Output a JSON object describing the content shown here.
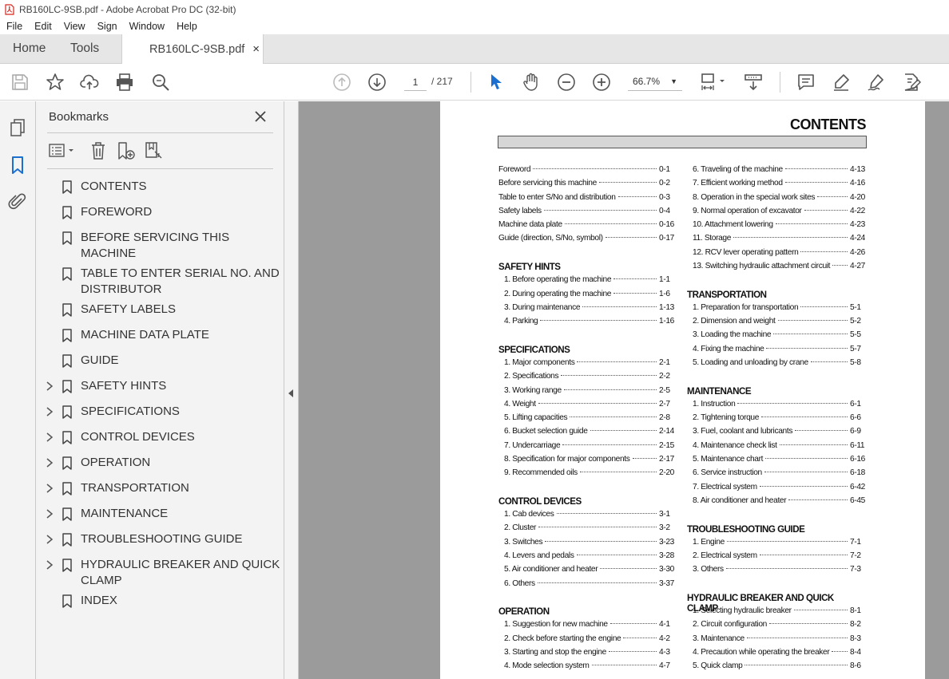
{
  "window": {
    "title": "RB160LC-9SB.pdf - Adobe Acrobat Pro DC (32-bit)"
  },
  "menu": [
    "File",
    "Edit",
    "View",
    "Sign",
    "Window",
    "Help"
  ],
  "tabs": {
    "home": "Home",
    "tools": "Tools",
    "document": "RB160LC-9SB.pdf",
    "close": "×"
  },
  "toolbar": {
    "page_current": "1",
    "page_total": "/ 217",
    "zoom": "66.7%"
  },
  "bookmarks": {
    "title": "Bookmarks",
    "items": [
      {
        "label": "CONTENTS",
        "expandable": false
      },
      {
        "label": "FOREWORD",
        "expandable": false
      },
      {
        "label": "BEFORE SERVICING THIS MACHINE",
        "expandable": false
      },
      {
        "label": "TABLE TO ENTER SERIAL NO. AND DISTRIBUTOR",
        "expandable": false
      },
      {
        "label": "SAFETY LABELS",
        "expandable": false
      },
      {
        "label": "MACHINE DATA PLATE",
        "expandable": false
      },
      {
        "label": "GUIDE",
        "expandable": false
      },
      {
        "label": "SAFETY HINTS",
        "expandable": true
      },
      {
        "label": "SPECIFICATIONS",
        "expandable": true
      },
      {
        "label": "CONTROL DEVICES",
        "expandable": true
      },
      {
        "label": "OPERATION",
        "expandable": true
      },
      {
        "label": "TRANSPORTATION",
        "expandable": true
      },
      {
        "label": "MAINTENANCE",
        "expandable": true
      },
      {
        "label": "TROUBLESHOOTING GUIDE",
        "expandable": true
      },
      {
        "label": "HYDRAULIC BREAKER AND QUICK CLAMP",
        "expandable": true
      },
      {
        "label": "INDEX",
        "expandable": false
      }
    ]
  },
  "document": {
    "heading": "CONTENTS",
    "left_column": [
      {
        "kind": "row",
        "text": "Foreword",
        "page": "0-1"
      },
      {
        "kind": "row",
        "text": "Before servicing this machine",
        "page": "0-2"
      },
      {
        "kind": "row",
        "text": "Table to enter S/No and distribution",
        "page": "0-3"
      },
      {
        "kind": "row",
        "text": "Safety labels",
        "page": "0-4"
      },
      {
        "kind": "row",
        "text": "Machine data plate",
        "page": "0-16"
      },
      {
        "kind": "row",
        "text": "Guide (direction, S/No, symbol)",
        "page": "0-17"
      },
      {
        "kind": "section",
        "text": "SAFETY HINTS"
      },
      {
        "kind": "item",
        "text": "1. Before operating the machine",
        "page": "1-1"
      },
      {
        "kind": "item",
        "text": "2. During operating the machine",
        "page": "1-6"
      },
      {
        "kind": "item",
        "text": "3. During maintenance",
        "page": "1-13"
      },
      {
        "kind": "item",
        "text": "4. Parking",
        "page": "1-16"
      },
      {
        "kind": "section",
        "text": "SPECIFICATIONS"
      },
      {
        "kind": "item",
        "text": "1. Major components",
        "page": "2-1"
      },
      {
        "kind": "item",
        "text": "2. Specifications",
        "page": "2-2"
      },
      {
        "kind": "item",
        "text": "3. Working range",
        "page": "2-5"
      },
      {
        "kind": "item",
        "text": "4. Weight",
        "page": "2-7"
      },
      {
        "kind": "item",
        "text": "5. Lifting capacities",
        "page": "2-8"
      },
      {
        "kind": "item",
        "text": "6. Bucket selection guide",
        "page": "2-14"
      },
      {
        "kind": "item",
        "text": "7. Undercarriage",
        "page": "2-15"
      },
      {
        "kind": "item",
        "text": "8. Specification for major components",
        "page": "2-17"
      },
      {
        "kind": "item",
        "text": "9. Recommended oils",
        "page": "2-20"
      },
      {
        "kind": "section",
        "text": "CONTROL DEVICES"
      },
      {
        "kind": "item",
        "text": "1. Cab devices",
        "page": "3-1"
      },
      {
        "kind": "item",
        "text": "2. Cluster",
        "page": "3-2"
      },
      {
        "kind": "item",
        "text": "3. Switches",
        "page": "3-23"
      },
      {
        "kind": "item",
        "text": "4. Levers and pedals",
        "page": "3-28"
      },
      {
        "kind": "item",
        "text": "5. Air conditioner and heater",
        "page": "3-30"
      },
      {
        "kind": "item",
        "text": "6. Others",
        "page": "3-37"
      },
      {
        "kind": "section",
        "text": "OPERATION"
      },
      {
        "kind": "item",
        "text": "1. Suggestion for new machine",
        "page": "4-1"
      },
      {
        "kind": "item",
        "text": "2. Check before starting the engine",
        "page": "4-2"
      },
      {
        "kind": "item",
        "text": "3. Starting and stop the engine",
        "page": "4-3"
      },
      {
        "kind": "item",
        "text": "4. Mode selection system",
        "page": "4-7"
      }
    ],
    "right_column": [
      {
        "kind": "item",
        "text": "6. Traveling of the machine",
        "page": "4-13"
      },
      {
        "kind": "item",
        "text": "7. Efficient working method",
        "page": "4-16"
      },
      {
        "kind": "item",
        "text": "8. Operation in the special work sites",
        "page": "4-20"
      },
      {
        "kind": "item",
        "text": "9. Normal operation of excavator",
        "page": "4-22"
      },
      {
        "kind": "item",
        "text": "10. Attachment lowering",
        "page": "4-23"
      },
      {
        "kind": "item",
        "text": "11. Storage",
        "page": "4-24"
      },
      {
        "kind": "item",
        "text": "12. RCV lever operating pattern",
        "page": "4-26"
      },
      {
        "kind": "item",
        "text": "13. Switching hydraulic attachment circuit",
        "page": "4-27"
      },
      {
        "kind": "section",
        "text": "TRANSPORTATION"
      },
      {
        "kind": "item",
        "text": "1. Preparation for transportation",
        "page": "5-1"
      },
      {
        "kind": "item",
        "text": "2. Dimension and weight",
        "page": "5-2"
      },
      {
        "kind": "item",
        "text": "3. Loading the machine",
        "page": "5-5"
      },
      {
        "kind": "item",
        "text": "4. Fixing the machine",
        "page": "5-7"
      },
      {
        "kind": "item",
        "text": "5. Loading and unloading by crane",
        "page": "5-8"
      },
      {
        "kind": "section",
        "text": "MAINTENANCE"
      },
      {
        "kind": "item",
        "text": "1. Instruction",
        "page": "6-1"
      },
      {
        "kind": "item",
        "text": "2. Tightening torque",
        "page": "6-6"
      },
      {
        "kind": "item",
        "text": "3. Fuel, coolant and lubricants",
        "page": "6-9"
      },
      {
        "kind": "item",
        "text": "4. Maintenance check list",
        "page": "6-11"
      },
      {
        "kind": "item",
        "text": "5. Maintenance chart",
        "page": "6-16"
      },
      {
        "kind": "item",
        "text": "6. Service instruction",
        "page": "6-18"
      },
      {
        "kind": "item",
        "text": "7. Electrical system",
        "page": "6-42"
      },
      {
        "kind": "item",
        "text": "8. Air conditioner and heater",
        "page": "6-45"
      },
      {
        "kind": "section",
        "text": "TROUBLESHOOTING GUIDE"
      },
      {
        "kind": "item",
        "text": "1. Engine",
        "page": "7-1"
      },
      {
        "kind": "item",
        "text": "2. Electrical system",
        "page": "7-2"
      },
      {
        "kind": "item",
        "text": "3. Others",
        "page": "7-3"
      },
      {
        "kind": "section",
        "text": "HYDRAULIC BREAKER AND QUICK CLAMP"
      },
      {
        "kind": "item",
        "text": "1. Selecting hydraulic breaker",
        "page": "8-1"
      },
      {
        "kind": "item",
        "text": "2. Circuit configuration",
        "page": "8-2"
      },
      {
        "kind": "item",
        "text": "3. Maintenance",
        "page": "8-3"
      },
      {
        "kind": "item",
        "text": "4. Precaution while operating the breaker",
        "page": "8-4"
      },
      {
        "kind": "item",
        "text": "5. Quick clamp",
        "page": "8-6"
      }
    ]
  },
  "colors": {
    "accent_blue": "#1a6fd1",
    "pdf_red": "#d7261b",
    "chrome_bg": "#f3f3f3",
    "canvas_gray": "#9b9b9b"
  }
}
